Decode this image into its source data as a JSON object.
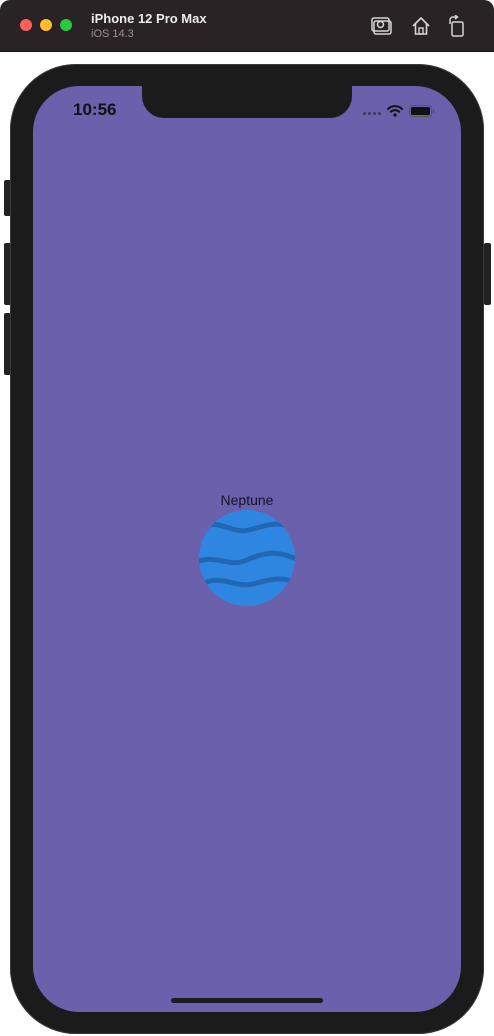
{
  "window": {
    "device_name": "iPhone 12 Pro Max",
    "os_version": "iOS 14.3",
    "toolbar_icons": [
      "screenshot-icon",
      "home-icon",
      "rotate-icon"
    ]
  },
  "status_bar": {
    "time": "10:56",
    "icons": [
      "signal-dots-icon",
      "wifi-icon",
      "battery-icon"
    ]
  },
  "content": {
    "planet_name": "Neptune",
    "planet_icon": "neptune-planet-icon"
  },
  "colors": {
    "screen_background": "#6a60ac",
    "planet_fill": "#2e86e0",
    "planet_bands": "#2167b4",
    "titlebar": "#2a2325"
  }
}
